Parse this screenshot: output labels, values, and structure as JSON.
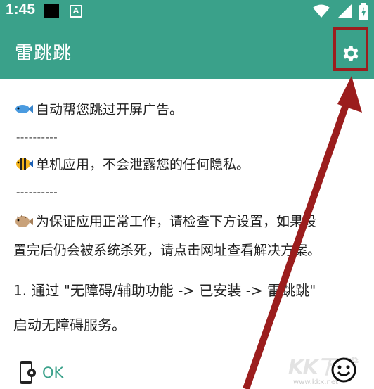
{
  "status_bar": {
    "time": "1:45",
    "notification_icon_letter": "A",
    "icons": [
      "wifi-icon",
      "signal-icon",
      "battery-charging-icon"
    ]
  },
  "app_bar": {
    "title": "雷跳跳",
    "settings_icon": "gear-icon"
  },
  "content": {
    "features": [
      {
        "icon": "fish-icon",
        "text": "自动帮您跳过开屏广告。"
      },
      {
        "icon": "tropical-fish-icon",
        "text": "单机应用，不会泄露您的任何隐私。"
      },
      {
        "icon": "blowfish-icon",
        "text_line1": "为保证应用正常工作，请检查下方设置，如果设",
        "text_line2": "置完后仍会被系统杀死，请点击网址查看解决方案。"
      }
    ],
    "separator": "----------",
    "step": {
      "line1": "1. 通过 \"无障碍/辅助功能 -> 已安装 -> 雷跳跳\"",
      "line2": "启动无障碍服务。"
    },
    "status": {
      "icon": "phone-settings-icon",
      "label": "OK"
    }
  },
  "overlay": {
    "highlight_color": "#9b1d1d",
    "watermark_text": "KK下载",
    "watermark_url": "www.kkx.net"
  },
  "colors": {
    "primary": "#3aa18a",
    "annotation": "#9b1d1d"
  }
}
